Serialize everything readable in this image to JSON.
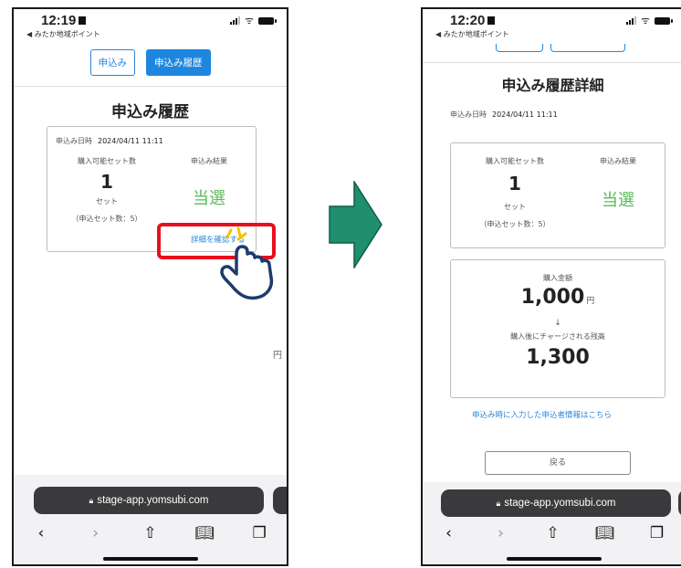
{
  "colors": {
    "accent": "#1f86e0",
    "win_green": "#5cb85c",
    "highlight_red": "#e8101c",
    "arrow_green": "#1f8f6e"
  },
  "left": {
    "status": {
      "time": "12:19",
      "back": "◀ みたか地域ポイント"
    },
    "tabs": {
      "apply": "申込み",
      "history": "申込み履歴"
    },
    "page_title": "申込み履歴",
    "card": {
      "date_label": "申込み日時",
      "date_value": "2024/04/11 11:11",
      "available_label": "購入可能セット数",
      "available_value": "1",
      "set_unit": "セット",
      "applied_note": "（申込セット数：5）",
      "result_label": "申込み結果",
      "result_value": "当選",
      "detail_link": "詳細を確認する"
    },
    "stray_yen": "円",
    "browser": {
      "url": "stage-app.yomsubi.com"
    }
  },
  "right": {
    "status": {
      "time": "12:20",
      "back": "◀ みたか地域ポイント"
    },
    "page_title": "申込み履歴詳細",
    "date_label": "申込み日時",
    "date_value": "2024/04/11 11:11",
    "card": {
      "available_label": "購入可能セット数",
      "available_value": "1",
      "set_unit": "セット",
      "applied_note": "（申込セット数：5）",
      "result_label": "申込み結果",
      "result_value": "当選"
    },
    "purchase": {
      "amount_label": "購入金額",
      "amount_value": "1,000",
      "amount_unit": "円",
      "arrow": "↓",
      "balance_label": "購入後にチャージされる残高",
      "balance_value": "1,300"
    },
    "applicant_link": "申込み時に入力した申込者情報はこちら",
    "back_button": "戻る",
    "browser": {
      "url": "stage-app.yomsubi.com"
    }
  },
  "icons": {
    "back": "chevron-left-icon",
    "forward": "chevron-right-icon",
    "share": "share-icon",
    "bookmarks": "book-icon",
    "tabs": "tabs-icon",
    "cursor": "pointing-hand-icon",
    "transition": "right-arrow-icon"
  }
}
